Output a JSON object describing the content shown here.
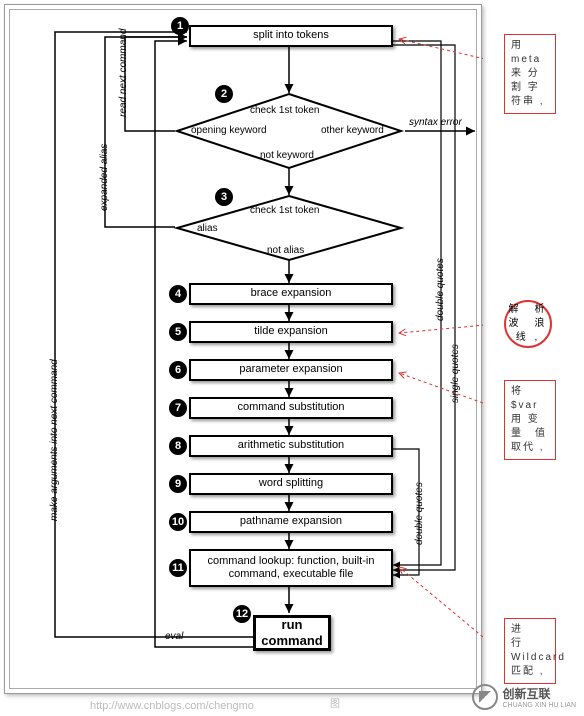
{
  "chart_data": {
    "type": "flowchart",
    "title": "Shell command line processing steps",
    "nodes": [
      {
        "id": 1,
        "label": "split into tokens",
        "shape": "rect"
      },
      {
        "id": 2,
        "label": "check 1st token",
        "shape": "diamond",
        "branches": [
          "opening keyword",
          "other keyword",
          "not keyword"
        ]
      },
      {
        "id": 3,
        "label": "check 1st token",
        "shape": "diamond",
        "branches": [
          "alias",
          "not alias"
        ]
      },
      {
        "id": 4,
        "label": "brace expansion",
        "shape": "rect"
      },
      {
        "id": 5,
        "label": "tilde expansion",
        "shape": "rect"
      },
      {
        "id": 6,
        "label": "parameter expansion",
        "shape": "rect"
      },
      {
        "id": 7,
        "label": "command substitution",
        "shape": "rect"
      },
      {
        "id": 8,
        "label": "arithmetic substitution",
        "shape": "rect"
      },
      {
        "id": 9,
        "label": "word splitting",
        "shape": "rect"
      },
      {
        "id": 10,
        "label": "pathname expansion",
        "shape": "rect"
      },
      {
        "id": 11,
        "label": "command lookup: function, built-in command, executable file",
        "shape": "rect"
      },
      {
        "id": 12,
        "label": "run command",
        "shape": "rect",
        "emphasis": true
      }
    ],
    "edges": [
      {
        "from": 1,
        "to": 2
      },
      {
        "from": 2,
        "to": 3,
        "label": "not keyword"
      },
      {
        "from": 2,
        "to": 1,
        "label": "opening keyword",
        "side": "read next command"
      },
      {
        "from": 2,
        "to": "exit",
        "label": "other keyword",
        "result": "syntax error"
      },
      {
        "from": 3,
        "to": 1,
        "label": "alias",
        "side": "expanded alias"
      },
      {
        "from": 3,
        "to": 4,
        "label": "not alias"
      },
      {
        "from": 4,
        "to": 5
      },
      {
        "from": 5,
        "to": 6
      },
      {
        "from": 6,
        "to": 7
      },
      {
        "from": 7,
        "to": 8
      },
      {
        "from": 8,
        "to": 9
      },
      {
        "from": 9,
        "to": 10
      },
      {
        "from": 10,
        "to": 11
      },
      {
        "from": 11,
        "to": 12
      },
      {
        "from": 12,
        "to": 1,
        "label": "make arguments into next command"
      },
      {
        "from": 12,
        "to": 1,
        "label": "eval"
      },
      {
        "group": "double quotes",
        "spans": [
          [
            1,
            11
          ],
          [
            8,
            11
          ]
        ]
      },
      {
        "group": "single quotes",
        "spans": [
          [
            1,
            11
          ]
        ]
      }
    ]
  },
  "steps": {
    "s1": "split into tokens",
    "s2": "check 1st token",
    "s2a": "opening keyword",
    "s2b": "other keyword",
    "s2c": "not keyword",
    "s3": "check 1st token",
    "s3a": "alias",
    "s3b": "not alias",
    "s4": "brace expansion",
    "s5": "tilde expansion",
    "s6": "parameter expansion",
    "s7": "command substitution",
    "s8": "arithmetic substitution",
    "s9": "word splitting",
    "s10": "pathname expansion",
    "s11": "command lookup: function, built-in command, executable file",
    "s12": "run command"
  },
  "nums": {
    "n1": "1",
    "n2": "2",
    "n3": "3",
    "n4": "4",
    "n5": "5",
    "n6": "6",
    "n7": "7",
    "n8": "8",
    "n9": "9",
    "n10": "10",
    "n11": "11",
    "n12": "12"
  },
  "labels": {
    "syntaxerr": "syntax error",
    "readnext": "read next command",
    "expanded": "expanded alias",
    "makeargs": "make arguments into next command",
    "eval": "eval",
    "dq": "double quotes",
    "sq": "single quotes"
  },
  "annotations": {
    "a1": "用　meta 来 分 割 字符串 ,",
    "a2": "解　析 波　浪 线 ,",
    "a3": "将$var用 变　量　值 取代 ,",
    "a4": "进　　行 Wildcard 匹配 ,"
  },
  "footer": {
    "watermark": "http://www.cnblogs.com/chengmo",
    "imgword": "图",
    "logo": "创新互联",
    "logosub": "CHUANG XIN HU LIAN"
  }
}
